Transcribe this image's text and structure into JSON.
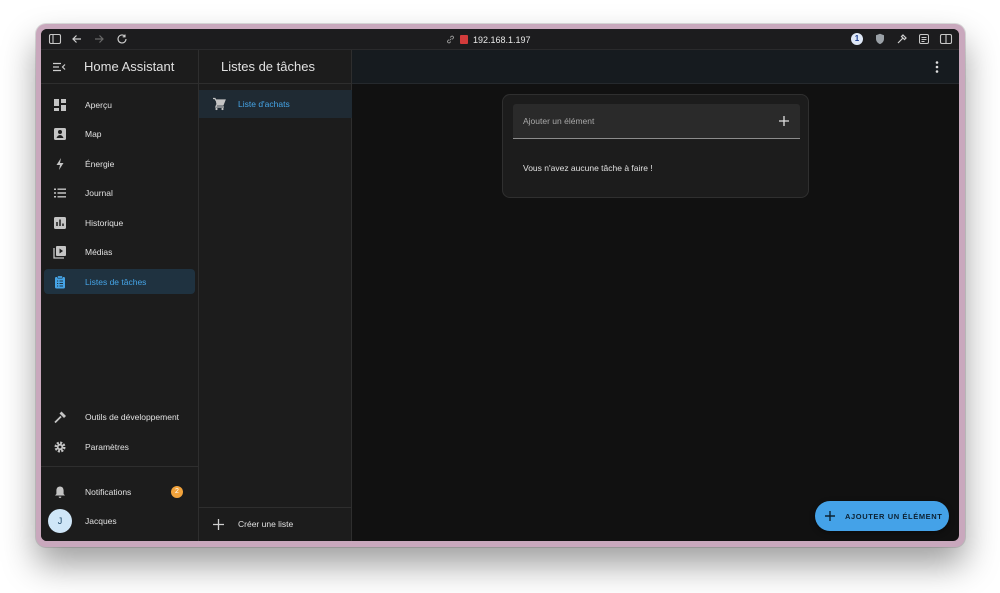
{
  "browser": {
    "url": "192.168.1.197"
  },
  "sidebar": {
    "title": "Home Assistant",
    "items": [
      {
        "label": "Aperçu",
        "icon": "dashboard-icon"
      },
      {
        "label": "Map",
        "icon": "map-icon"
      },
      {
        "label": "Énergie",
        "icon": "lightning-icon"
      },
      {
        "label": "Journal",
        "icon": "list-icon"
      },
      {
        "label": "Historique",
        "icon": "chart-icon"
      },
      {
        "label": "Médias",
        "icon": "media-icon"
      },
      {
        "label": "Listes de tâches",
        "icon": "clipboard-list-icon",
        "active": true
      }
    ],
    "bottom_items": [
      {
        "label": "Outils de développement",
        "icon": "hammer-icon"
      },
      {
        "label": "Paramètres",
        "icon": "gear-icon"
      }
    ],
    "notifications": {
      "label": "Notifications",
      "count": "2"
    },
    "user": {
      "name": "Jacques",
      "initial": "J"
    }
  },
  "lists_pane": {
    "title": "Listes de tâches",
    "items": [
      {
        "label": "Liste d'achats",
        "icon": "cart-icon"
      }
    ],
    "create_label": "Créer une liste"
  },
  "main": {
    "add_item_placeholder": "Ajouter un élément",
    "empty_message": "Vous n'avez aucune tâche à faire !",
    "fab_label": "AJOUTER UN ÉLÉMENT"
  },
  "colors": {
    "accent": "#44a2e8",
    "badge": "#f2a33c",
    "active_bg": "#1f3240"
  }
}
